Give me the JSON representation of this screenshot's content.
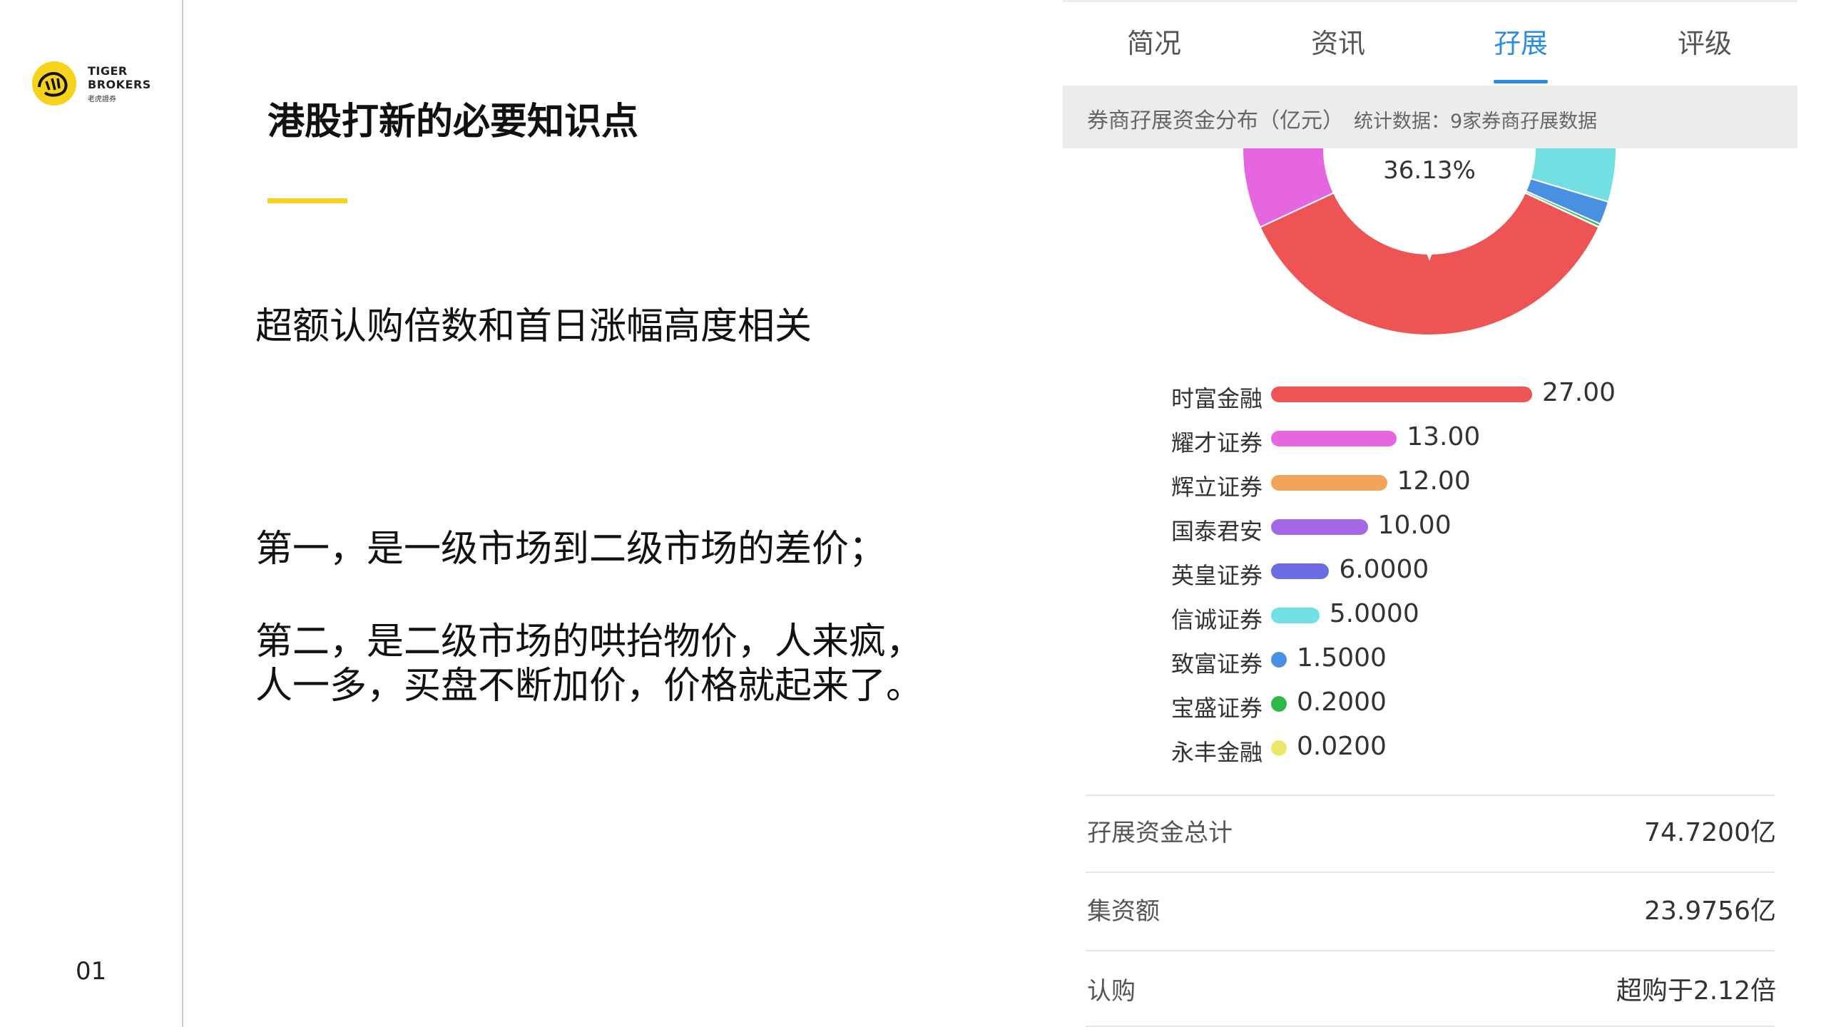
{
  "logo": {
    "line1": "TIGER",
    "line2": "BROKERS",
    "line3": "老虎證券"
  },
  "slide": {
    "title": "港股打新的必要知识点",
    "subtitle": "超额认购倍数和首日涨幅高度相关",
    "point1": "第一，是一级市场到二级市场的差价；",
    "point2_line1": "第二，是二级市场的哄抬物价，人来疯，",
    "point2_line2": "人一多，买盘不断加价，价格就起来了。",
    "page_number": "01"
  },
  "panel": {
    "tabs": [
      {
        "label": "简况",
        "active": false
      },
      {
        "label": "资讯",
        "active": false
      },
      {
        "label": "孖展",
        "active": true
      },
      {
        "label": "评级",
        "active": false
      }
    ],
    "header_title": "券商孖展资金分布（亿元）",
    "header_note": "统计数据：9家券商孖展数据",
    "donut_label": "36.13%",
    "stats": [
      {
        "label": "孖展资金总计",
        "value": "74.7200亿"
      },
      {
        "label": "集资额",
        "value": "23.9756亿"
      },
      {
        "label": "认购",
        "value": "超购于2.12倍"
      }
    ]
  },
  "chart_data": {
    "type": "bar",
    "orientation": "horizontal",
    "categories": [
      "时富金融",
      "耀才证券",
      "辉立证券",
      "国泰君安",
      "英皇证券",
      "信诚证券",
      "致富证券",
      "宝盛证券",
      "永丰金融"
    ],
    "values": [
      27.0,
      13.0,
      12.0,
      10.0,
      6.0,
      5.0,
      1.5,
      0.2,
      0.02
    ],
    "value_labels": [
      "27.00",
      "13.00",
      "12.00",
      "10.00",
      "6.0000",
      "5.0000",
      "1.5000",
      "0.2000",
      "0.0200"
    ],
    "colors": [
      "#ee5454",
      "#e566e0",
      "#f1a45a",
      "#a468e6",
      "#6b6be2",
      "#72e0e2",
      "#4a90e2",
      "#2fb84a",
      "#ece86a"
    ],
    "title": "券商孖展资金分布（亿元）"
  }
}
